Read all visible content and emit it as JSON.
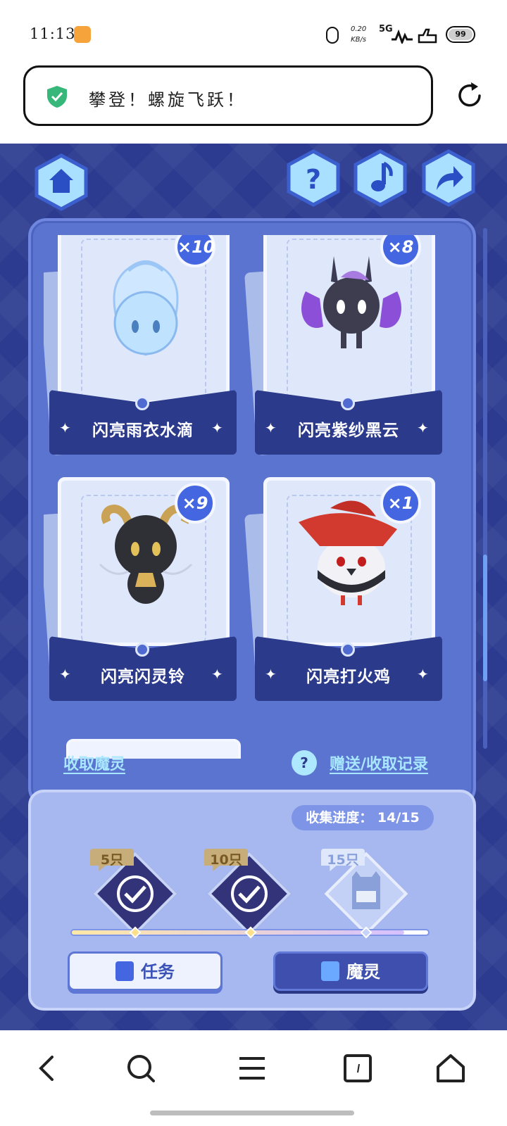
{
  "status": {
    "time": "11:13",
    "speed_value": "0.20",
    "speed_unit": "KB/s",
    "network": "5G",
    "battery": "99"
  },
  "browser": {
    "page_title": "攀登！螺旋飞跃！"
  },
  "game": {
    "top_buttons": [
      "home-icon",
      "help-icon",
      "music-icon",
      "share-icon"
    ],
    "cards": [
      {
        "name": "闪亮雨衣水滴",
        "count": "×10"
      },
      {
        "name": "闪亮紫纱黑云",
        "count": "×8"
      },
      {
        "name": "闪亮闪灵铃",
        "count": "×9"
      },
      {
        "name": "闪亮打火鸡",
        "count": "×1"
      }
    ],
    "collect_link": "收取魔灵",
    "help_mark": "?",
    "record_link": "赠送/收取记录",
    "progress_text": "收集进度：  14/15",
    "progress": {
      "current": 14,
      "total": 15
    },
    "milestones": [
      {
        "label": "5只",
        "claimed": true
      },
      {
        "label": "10只",
        "claimed": true
      },
      {
        "label": "15只",
        "claimed": false
      }
    ],
    "task_button": "任务",
    "mo_button": "魔灵"
  },
  "colors": {
    "bg": "#2c3b8f",
    "panel": "#5b74d0",
    "accent": "#4466e0",
    "link": "#a8e7ff"
  }
}
